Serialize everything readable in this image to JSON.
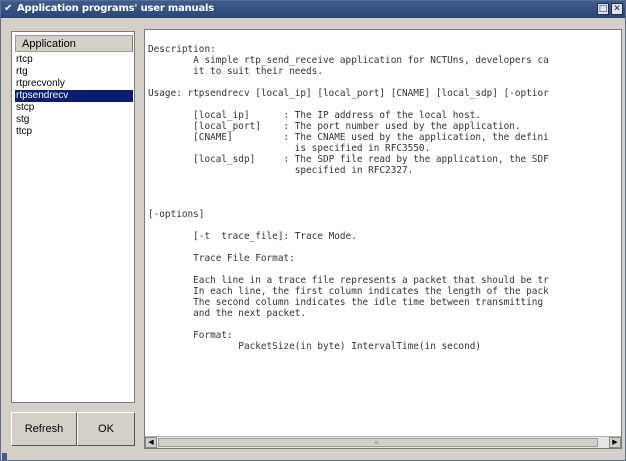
{
  "window": {
    "title": "Application programs' user manuals",
    "app_icon": "checkmark-icon",
    "controls": {
      "maximize_icon": "maximize-icon",
      "close_icon": "close-icon"
    }
  },
  "app_list": {
    "header": "Application",
    "items": [
      "rtcp",
      "rtg",
      "rtprecvonly",
      "rtpsendrecv",
      "stcp",
      "stg",
      "ttcp"
    ],
    "selected_index": 3
  },
  "buttons": {
    "refresh_label": "Refresh",
    "ok_label": "OK"
  },
  "manual": {
    "lines": [
      "Description:",
      "        A simple rtp_send_receive application for NCTUns, developers ca",
      "        it to suit their needs.",
      "",
      "Usage: rtpsendrecv [local_ip] [local_port] [CNAME] [local_sdp] [-optior",
      "",
      "        [local_ip]      : The IP address of the local host.",
      "        [local_port]    : The port number used by the application.",
      "        [CNAME]         : The CNAME used by the application, the defini",
      "                          is specified in RFC3550.",
      "        [local_sdp]     : The SDP file read by the application, the SDF",
      "                          specified in RFC2327.",
      "",
      "",
      "",
      "[-options]",
      "",
      "        [-t  trace_file]: Trace Mode.",
      "",
      "        Trace File Format:",
      "",
      "        Each line in a trace file represents a packet that should be tr",
      "        In each line, the first column indicates the length of the pack",
      "        The second column indicates the idle time between transmitting",
      "        and the next packet.",
      "",
      "        Format:",
      "                PacketSize(in byte) IntervalTime(in second)"
    ]
  },
  "scrollbar": {
    "left_arrow": "◀",
    "right_arrow": "▶",
    "left_icon": "scroll-left-icon",
    "right_icon": "scroll-right-icon"
  }
}
